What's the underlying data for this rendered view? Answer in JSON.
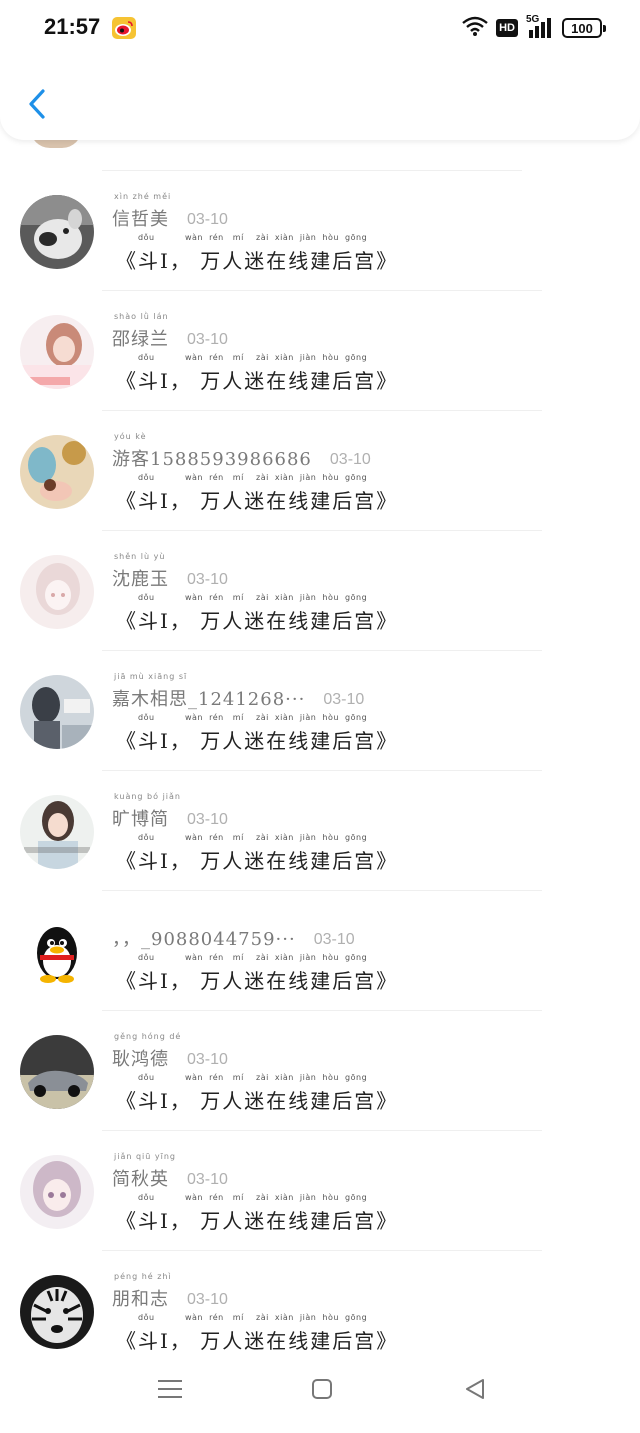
{
  "status_bar": {
    "time": "21:57",
    "network": "5G",
    "hd": "HD",
    "battery": "100"
  },
  "header": {
    "back_icon": "chevron-left-icon"
  },
  "colors": {
    "accent": "#1e90e8",
    "name_gray": "#7a7a7a",
    "date_gray": "#b0b0b0"
  },
  "list": {
    "items": [
      {
        "name": "信哲美",
        "name_pinyin": "xìn  zhé  měi",
        "date": "03-10",
        "message": "《斗I， 万人迷在线建后宫》",
        "message_pinyin": "dǒu          wàn  rén   mí    zài  xiàn  jiàn  hòu  gōng",
        "avatar": "dog-avatar"
      },
      {
        "name": "邵绿兰",
        "name_pinyin": "shào  lǜ   lán",
        "date": "03-10",
        "message": "《斗I， 万人迷在线建后宫》",
        "message_pinyin": "dǒu          wàn  rén   mí    zài  xiàn  jiàn  hòu  gōng",
        "avatar": "girl-avatar"
      },
      {
        "name": "游客1588593986686",
        "name_pinyin": "yóu  kè",
        "date": "03-10",
        "message": "《斗I， 万人迷在线建后宫》",
        "message_pinyin": "dǒu          wàn  rén   mí    zài  xiàn  jiàn  hòu  gōng",
        "avatar": "cartoon-avatar"
      },
      {
        "name": "沈鹿玉",
        "name_pinyin": "shěn  lù   yù",
        "date": "03-10",
        "message": "《斗I， 万人迷在线建后宫》",
        "message_pinyin": "dǒu          wàn  rén   mí    zài  xiàn  jiàn  hòu  gōng",
        "avatar": "anime-avatar"
      },
      {
        "name": "嘉木相思_1241268···",
        "name_pinyin": "jiā   mù  xiāng  sī",
        "date": "03-10",
        "message": "《斗I， 万人迷在线建后宫》",
        "message_pinyin": "dǒu          wàn  rén   mí    zài  xiàn  jiàn  hòu  gōng",
        "avatar": "photo-avatar"
      },
      {
        "name": "旷博简",
        "name_pinyin": "kuàng  bó  jiǎn",
        "date": "03-10",
        "message": "《斗I， 万人迷在线建后宫》",
        "message_pinyin": "dǒu          wàn  rén   mí    zài  xiàn  jiàn  hòu  gōng",
        "avatar": "woman-avatar"
      },
      {
        "name": "，，_9088044759···",
        "name_pinyin": "",
        "date": "03-10",
        "message": "《斗I， 万人迷在线建后宫》",
        "message_pinyin": "dǒu          wàn  rén   mí    zài  xiàn  jiàn  hòu  gōng",
        "avatar": "penguin-avatar"
      },
      {
        "name": "耿鸿德",
        "name_pinyin": "gěng hóng  dé",
        "date": "03-10",
        "message": "《斗I， 万人迷在线建后宫》",
        "message_pinyin": "dǒu          wàn  rén   mí    zài  xiàn  jiàn  hòu  gōng",
        "avatar": "car-avatar"
      },
      {
        "name": "简秋英",
        "name_pinyin": "jiǎn  qiū  yīng",
        "date": "03-10",
        "message": "《斗I， 万人迷在线建后宫》",
        "message_pinyin": "dǒu          wàn  rén   mí    zài  xiàn  jiàn  hòu  gōng",
        "avatar": "anime-girl-avatar"
      },
      {
        "name": "朋和志",
        "name_pinyin": "péng  hé  zhì",
        "date": "03-10",
        "message": "《斗I， 万人迷在线建后宫》",
        "message_pinyin": "dǒu          wàn  rén   mí    zài  xiàn  jiàn  hòu  gōng",
        "avatar": "tiger-avatar"
      }
    ]
  },
  "nav_bar": {
    "menu_icon": "menu-icon",
    "home_icon": "home-square-icon",
    "back_icon": "back-triangle-icon"
  }
}
